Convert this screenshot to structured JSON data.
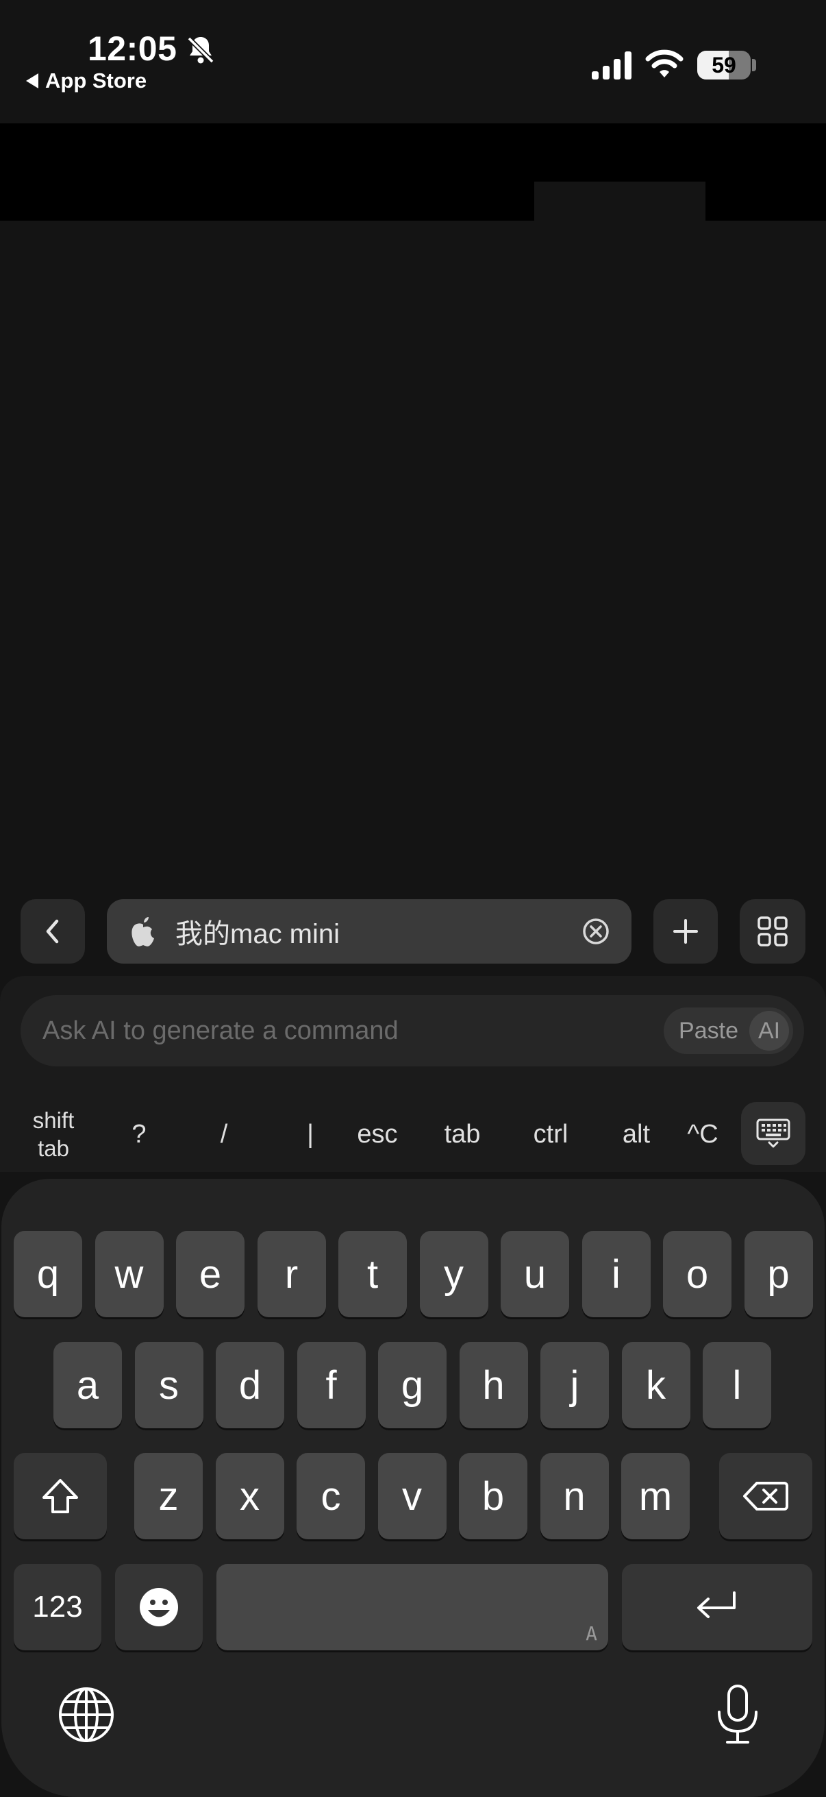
{
  "status_bar": {
    "time": "12:05",
    "back_app": "App Store",
    "battery": "59",
    "battery_level_pct": 59,
    "icons": [
      "bell-slash-icon",
      "signal-icon",
      "wifi-icon",
      "battery-icon"
    ]
  },
  "toolbar": {
    "host_name": "我的mac mini",
    "icons": [
      "chevron-left-icon",
      "apple-icon",
      "clear-icon",
      "plus-icon",
      "grid-icon"
    ]
  },
  "ai_bar": {
    "placeholder": "Ask AI to generate a command",
    "paste_label": "Paste",
    "ai_label": "AI"
  },
  "special_keys": {
    "shift": "shift",
    "tab_under_shift": "tab",
    "question": "?",
    "slash": "/",
    "pipe": "|",
    "esc": "esc",
    "tab": "tab",
    "ctrl": "ctrl",
    "alt": "alt",
    "ctrl_c": "^C"
  },
  "keyboard": {
    "row1": [
      "q",
      "w",
      "e",
      "r",
      "t",
      "y",
      "u",
      "i",
      "o",
      "p"
    ],
    "row2": [
      "a",
      "s",
      "d",
      "f",
      "g",
      "h",
      "j",
      "k",
      "l"
    ],
    "row3": [
      "z",
      "x",
      "c",
      "v",
      "b",
      "n",
      "m"
    ],
    "numbers_label": "123",
    "space_hint": "A"
  }
}
